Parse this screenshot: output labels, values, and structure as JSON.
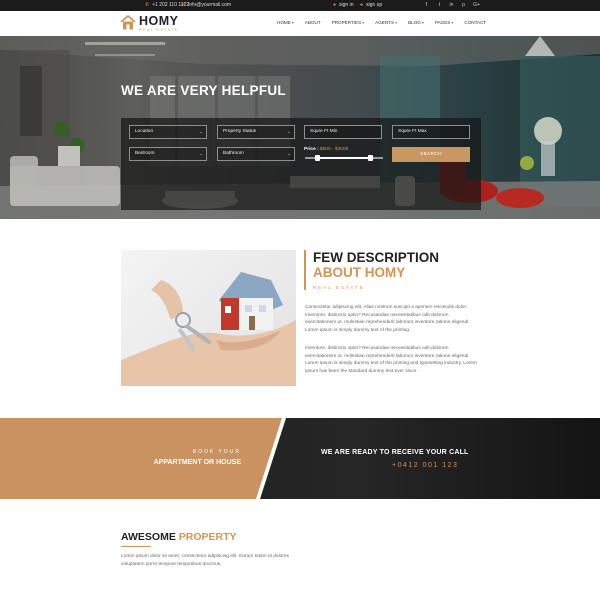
{
  "topbar": {
    "phone": "+1 202 110 1122",
    "email": "info@yourmail.com",
    "sign_in": "sign in",
    "sign_up": "sign up",
    "social": [
      "f",
      "t",
      "in",
      "p",
      "G+"
    ]
  },
  "brand": {
    "name": "HOMY",
    "tagline": "REAL ESTATE"
  },
  "nav": {
    "items": [
      {
        "label": "HOME",
        "dropdown": true
      },
      {
        "label": "ABOUT",
        "dropdown": false
      },
      {
        "label": "PROPERTIES",
        "dropdown": true
      },
      {
        "label": "AGENTS",
        "dropdown": true
      },
      {
        "label": "BLOG",
        "dropdown": true
      },
      {
        "label": "PAGES",
        "dropdown": true
      },
      {
        "label": "CONTACT",
        "dropdown": false
      }
    ]
  },
  "hero": {
    "title": "WE ARE VERY HELPFUL",
    "location": "Location",
    "property_status": "Property Status",
    "sqft_min": "Squre Ft Min",
    "sqft_max": "Squre Ft Max",
    "bedroom": "Bedroom",
    "bathroom": "Bathroom",
    "price_label": "Price :",
    "price_range": "$500 - $3000",
    "price_min_fraction": 0.16,
    "price_max_fraction": 0.84,
    "search_label": "SEARCH"
  },
  "about": {
    "title_line1": "FEW DESCRIPTION",
    "title_line2": "ABOUT HOMY",
    "subtitle": "REAL ESTATE",
    "para1": "Consectetur adipiscing elit. Alias nostrum suscipit a aperiam reiciendis dolor. Inventore, distinctio optio? Recusandae necessitatibus odit dolorum exercitationem ut, molestiae reprehenderit laborum inventore ratione eligendi Lorem ipsum is simply dummy text of the printing.",
    "para2": "Inventore, distinctio optio? Recusandae necessitatibus odit dolorum exercitationem ut, molestiae reprehenderit laborum inventore ratione eligendi Lorem ipsum is simply dummy text of the printing and typesetting industry. Lorem Ipsum has been the standard dummy text ever since."
  },
  "banner": {
    "book_line1": "BOOK YOUR",
    "book_line2": "APPARTMENT OR HOUSE",
    "ready": "WE ARE READY TO RECEIVE YOUR CALL",
    "phone": "+0412 001 123"
  },
  "awesome": {
    "title_a": "AWESOME",
    "title_b": "PROPERTY",
    "text": "Lorem ipsum dolor sit amet, consectetur adipiscing elit. Earum totam et dolores voluptatem porro tempore temporibus ducimus."
  },
  "colors": {
    "accent": "#d19454",
    "dark": "#1b1b1b",
    "banner_tan": "#c99260"
  }
}
